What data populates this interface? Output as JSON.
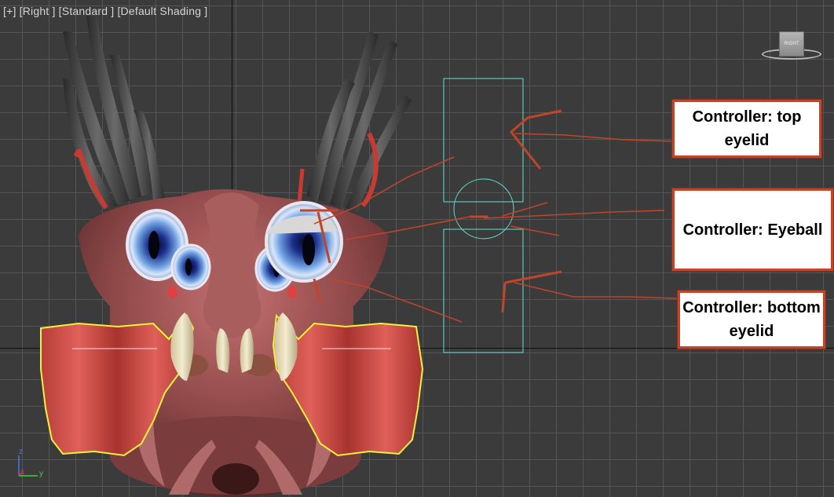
{
  "viewport": {
    "label": "[+] [Right ] [Standard ] [Default Shading ]"
  },
  "viewcube": {
    "face_label": "RIGHT"
  },
  "axis_gizmo": {
    "z": "z",
    "x": "x",
    "y": "y"
  },
  "callouts": {
    "top": "Controller: top eyelid",
    "eyeball": "Controller: Eyeball",
    "bottom": "Controller: bottom eyelid"
  },
  "colors": {
    "grid_background": "#3b3b3b",
    "grid_line": "#555555",
    "controller_cyan": "#5fe0d0",
    "selection_yellow": "#f2f23a",
    "annotation_red": "#c0452a",
    "creature_skin": "#9c5252"
  }
}
